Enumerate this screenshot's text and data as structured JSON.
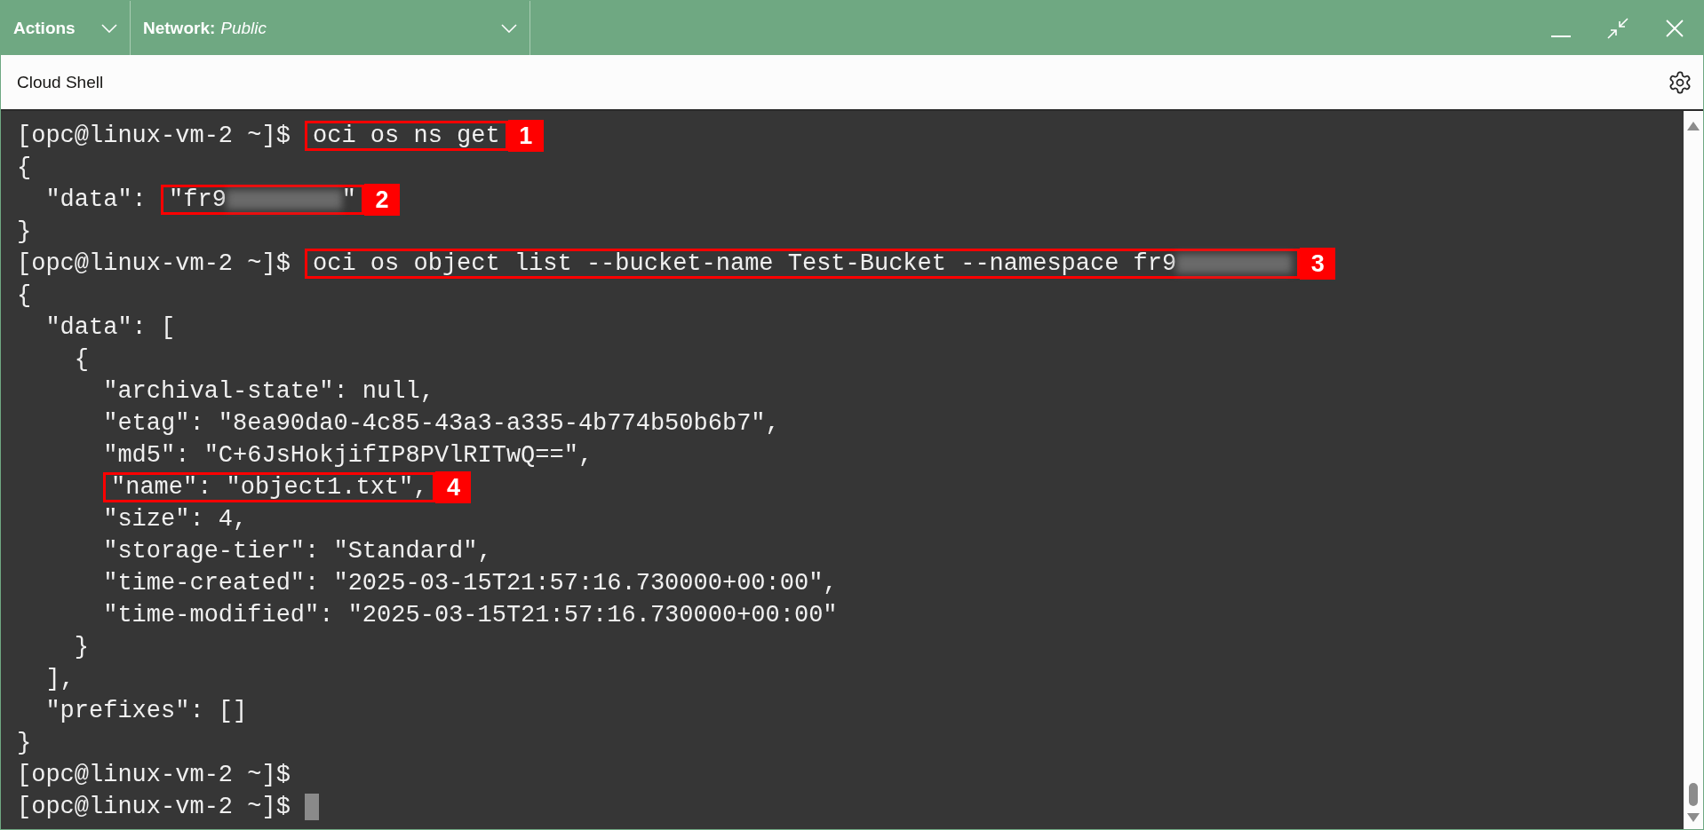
{
  "toolbar": {
    "actions": "Actions",
    "network_label": "Network:",
    "network_value": "Public"
  },
  "header": {
    "title": "Cloud Shell"
  },
  "terminal": {
    "lines": [
      {
        "text": "[opc@linux-vm-2 ~]$ ",
        "boxed": {
          "text": "oci os ns get",
          "number": "1"
        }
      },
      {
        "text": "{"
      },
      {
        "text": "  \"data\": ",
        "boxed": {
          "text": "\"fr9",
          "redacted": true,
          "tail": "\"",
          "number": "2"
        }
      },
      {
        "text": "}"
      },
      {
        "text": "[opc@linux-vm-2 ~]$ ",
        "boxed": {
          "text": "oci os object list --bucket-name Test-Bucket --namespace fr9",
          "redacted": true,
          "number": "3"
        }
      },
      {
        "text": "{"
      },
      {
        "text": "  \"data\": ["
      },
      {
        "text": "    {"
      },
      {
        "text": "      \"archival-state\": null,"
      },
      {
        "text": "      \"etag\": \"8ea90da0-4c85-43a3-a335-4b774b50b6b7\","
      },
      {
        "text": "      \"md5\": \"C+6JsHokjifIP8PVlRITwQ==\","
      },
      {
        "boxed": {
          "text": "\"name\": \"object1.txt\",",
          "number": "4"
        }
      },
      {
        "text": "      \"size\": 4,"
      },
      {
        "text": "      \"storage-tier\": \"Standard\","
      },
      {
        "text": "      \"time-created\": \"2025-03-15T21:57:16.730000+00:00\","
      },
      {
        "text": "      \"time-modified\": \"2025-03-15T21:57:16.730000+00:00\""
      },
      {
        "text": "    }"
      },
      {
        "text": "  ],"
      },
      {
        "text": "  \"prefixes\": []"
      },
      {
        "text": "}"
      },
      {
        "text": "[opc@linux-vm-2 ~]$"
      },
      {
        "text": "[opc@linux-vm-2 ~]$ ",
        "cursor": true
      }
    ]
  }
}
